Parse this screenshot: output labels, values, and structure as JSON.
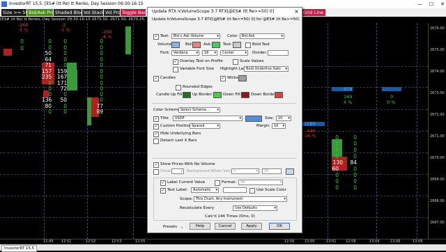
{
  "window": {
    "title": "InvestorRT 15.5: [ES# (tt Re) tt Renko, Day Session 09:30-16:15",
    "min": "—",
    "max": "☐",
    "close": "✕"
  },
  "toolbar": {
    "items": [
      {
        "label": "Size  >= 50",
        "bg": "#1a1a1a"
      },
      {
        "label": "Bid/Ask Prof",
        "bg": "#4a8a1a"
      },
      {
        "label": "Shaded Block",
        "bg": "#2a2a2a"
      },
      {
        "label": "Vol Stack",
        "bg": "#2a2a2a"
      },
      {
        "label": "Vol Prof",
        "bg": "#2a2a2a"
      },
      {
        "label": "Toggle Back",
        "bg": "#c21e4a"
      },
      {
        "label": "Grid Line",
        "bg": "#c21e4a"
      }
    ]
  },
  "subbar": {
    "text": "[ES# (tt Re) tt Renko, Day Session 09:30-16:15   2675.50, 2671.50, 2670.25, 2671.50, ..."
  },
  "chart": {
    "pct_labels": [
      {
        "text": "-200",
        "color": "#d05050"
      },
      {
        "text": "-5 %",
        "color": "#e03030"
      },
      {
        "text": "-2",
        "color": "#d05050"
      },
      {
        "text": "-1 %",
        "color": "#e03030"
      },
      {
        "text": "-200",
        "color": "#d05050"
      },
      {
        "text": "-6 %",
        "color": "#e03030"
      },
      {
        "text": "979",
        "color": "#40b0ff"
      },
      {
        "text": "169",
        "color": "#40c040"
      },
      {
        "text": "4 %",
        "color": "#40c040"
      },
      {
        "text": "0",
        "color": "#40c040"
      },
      {
        "text": "0 %",
        "color": "#40c040"
      },
      {
        "text": "1780",
        "color": "#40b0ff"
      },
      {
        "text": "-446",
        "color": "#e03030"
      },
      {
        "text": "-16 %",
        "color": "#e03030"
      }
    ],
    "left_rows": [
      {
        "bid": "0",
        "ask": "0"
      },
      {
        "bid": "0",
        "ask": "0"
      },
      {
        "bid": "50",
        "ask": "0"
      },
      {
        "bid": "64",
        "ask": "0"
      },
      {
        "bid": "71",
        "ask": "0"
      },
      {
        "bid": "157",
        "ask": "159"
      },
      {
        "bid": "235",
        "ask": "167"
      },
      {
        "bid": "0",
        "ask": "171"
      },
      {
        "bid": "0",
        "ask": "72"
      },
      {
        "bid": "0",
        "ask": "0"
      },
      {
        "bid": "136",
        "ask": "50"
      },
      {
        "bid": "80",
        "ask": "0"
      },
      {
        "bid": "0",
        "ask": "0"
      }
    ],
    "col3_rows": [
      "0",
      "0",
      "0",
      "0",
      "0",
      "0",
      "0",
      "0",
      "0",
      "0",
      "0",
      "77",
      "89"
    ],
    "right_rows": [
      {
        "bid": "0",
        "ask": "0"
      },
      {
        "bid": "0",
        "ask": "0"
      },
      {
        "bid": "0",
        "ask": "0"
      },
      {
        "bid": "0",
        "ask": "0"
      },
      {
        "bid": "130",
        "ask": "84"
      },
      {
        "bid": "60",
        "ask": "0"
      },
      {
        "bid": "0",
        "ask": "0"
      },
      {
        "bid": "0",
        "ask": "0"
      },
      {
        "bid": "0",
        "ask": "0"
      }
    ],
    "price_labels": [
      "2676.00",
      "2675.00",
      "2674.00",
      "2673.00",
      "2672.00",
      "2671.00",
      "2670.00",
      "2669.00",
      "2668.00",
      "2667.00"
    ],
    "time_labels": [
      "12:49",
      "12:51",
      "12:52",
      "12:53",
      "12:55",
      "13:00",
      "13:01",
      "12:58",
      "13:04",
      "13:06",
      "12:56",
      "13:09"
    ]
  },
  "status": {
    "tab": "InvestorRT 15.5"
  },
  "dialog": {
    "title": "Update RTX IcVolumeScope 3.7 RTX[@ES# (tt Re>=50) 0]",
    "subtitle": "Update IcVolumeScope 3.7 RTX[@ES# (tt Re>=50) 0] for @ES# (tt Re>=50)",
    "text_label": "Text:",
    "text_value": "Bid x Ask Volume",
    "color_label": "Color:",
    "color_value": "Bid Ask",
    "volume_label": "Volume:",
    "bid_label": "Bid:",
    "ask_label": "Ask:",
    "text2_label": "Text:",
    "bold_text": "Bold Text",
    "font_label": "Font:",
    "font_value": "Verdana",
    "size_value": "18",
    "align_value": "Center",
    "divider_label": "Divider:",
    "overlay": "Overlay Text on Profile",
    "scale_values": "Scale Values",
    "variable_font": "Variable Font Size",
    "highlight_last": "Highlight Last:",
    "highlight_value": "Bold Underline Italic",
    "candles": "Candles",
    "wicks": "Wicks",
    "rounded": "Rounded Edges",
    "candle_up": "Candle Up Fill:",
    "up_border": "Up Border:",
    "down_fill": "Down Fill:",
    "down_border": "Down Border:",
    "color_scheme_label": "Color Scheme:",
    "color_scheme_value": "Select Scheme...",
    "title_label": "Title",
    "title_value": "VSDP",
    "size_label": "Size:",
    "size2_value": "10",
    "custom_position": "Custom Position",
    "position_value": "Spaced",
    "margin_label": "Margin",
    "margin_value": "10",
    "hide_bars": "Hide Underlying Bars",
    "detach": "Detach Last X Bars",
    "show_prices": "Show Prices With No Volume",
    "show_label": "Show",
    "bg_volume": "Background When Volume:",
    "bg_op": ">",
    "bg_value": "25",
    "label_current": "Label Current Value",
    "format_label": "Format:",
    "format_value": "99",
    "text_label2": "Text Label:",
    "text_label_value": "Automatic",
    "use_scale": "Use Scale Color",
    "scope_label": "Scope:",
    "scope_value": "This Chart, Any Instrument",
    "recalc_label": "Recalculate Every",
    "recalc_value": "Use Defaults",
    "calc_info": "Calc'd 144 Times (0ms, 0)",
    "presets": "Presets",
    "help": "Help",
    "cancel": "Cancel",
    "apply": "Apply",
    "ok": "OK",
    "colors": {
      "volume": "#8ab4e8",
      "bid": "#f08080",
      "ask": "#40d060",
      "text": "#c8c8c8",
      "wicks": "#a0a0a0",
      "candle_up": "#207020",
      "up_border": "#40d040",
      "down_fill": "#8b1a1a",
      "down_border": "#e04040",
      "title_color": "#4a90e2"
    }
  }
}
